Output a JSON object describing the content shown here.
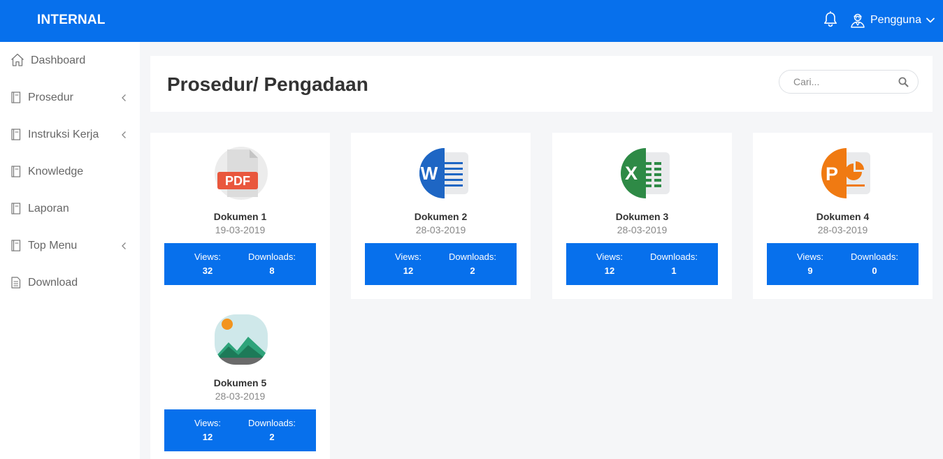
{
  "app": {
    "brand": "INTERNAL"
  },
  "topbar": {
    "user_name": "Pengguna",
    "icons": [
      "bell-icon",
      "user-icon",
      "chevron-down-icon"
    ]
  },
  "colors": {
    "primary": "#0770ec",
    "background": "#f5f6f8",
    "card": "#ffffff",
    "text": "#333333",
    "muted": "#888888"
  },
  "sidebar": {
    "items": [
      {
        "label": "Dashboard",
        "icon": "home-icon",
        "submenu": false
      },
      {
        "label": "Prosedur",
        "icon": "document-icon",
        "submenu": true
      },
      {
        "label": "Instruksi Kerja",
        "icon": "document-icon",
        "submenu": true
      },
      {
        "label": "Knowledge",
        "icon": "document-icon",
        "submenu": false
      },
      {
        "label": "Laporan",
        "icon": "document-icon",
        "submenu": false
      },
      {
        "label": "Top Menu",
        "icon": "document-icon",
        "submenu": true
      },
      {
        "label": "Download",
        "icon": "file-icon",
        "submenu": false
      }
    ]
  },
  "header": {
    "title": "Prosedur/ Pengadaan",
    "search_placeholder": "Cari..."
  },
  "documents": [
    {
      "name": "Dokumen 1",
      "date": "19-03-2019",
      "type": "pdf",
      "icon": "pdf-file-icon",
      "views_label": "Views:",
      "views": "32",
      "downloads_label": "Downloads:",
      "downloads": "8"
    },
    {
      "name": "Dokumen 2",
      "date": "28-03-2019",
      "type": "word",
      "icon": "word-file-icon",
      "views_label": "Views:",
      "views": "12",
      "downloads_label": "Downloads:",
      "downloads": "2"
    },
    {
      "name": "Dokumen 3",
      "date": "28-03-2019",
      "type": "excel",
      "icon": "excel-file-icon",
      "views_label": "Views:",
      "views": "12",
      "downloads_label": "Downloads:",
      "downloads": "1"
    },
    {
      "name": "Dokumen 4",
      "date": "28-03-2019",
      "type": "powerpoint",
      "icon": "powerpoint-file-icon",
      "views_label": "Views:",
      "views": "9",
      "downloads_label": "Downloads:",
      "downloads": "0"
    },
    {
      "name": "Dokumen 5",
      "date": "28-03-2019",
      "type": "image",
      "icon": "image-file-icon",
      "views_label": "Views:",
      "views": "12",
      "downloads_label": "Downloads:",
      "downloads": "2"
    }
  ]
}
